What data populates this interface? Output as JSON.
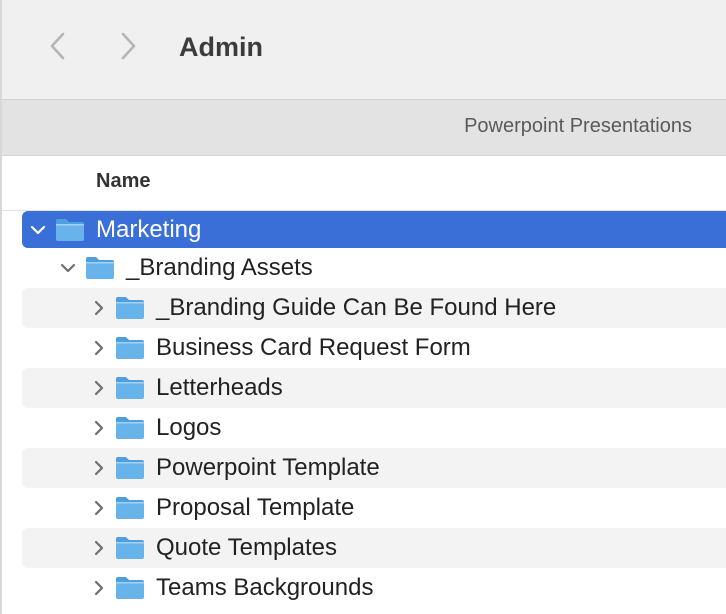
{
  "window": {
    "title": "Admin"
  },
  "pathbar": {
    "label": "Powerpoint Presentations"
  },
  "columns": {
    "name": "Name"
  },
  "colors": {
    "selection": "#3a6fd8",
    "folder": "#69b3eb",
    "zebra": "#f3f3f3"
  },
  "rows": [
    {
      "label": "Marketing",
      "level": 0,
      "expanded": true,
      "selected": true,
      "icon": "folder-icon"
    },
    {
      "label": "_Branding Assets",
      "level": 1,
      "expanded": true,
      "selected": false,
      "icon": "folder-icon"
    },
    {
      "label": "_Branding Guide Can Be Found Here",
      "level": 2,
      "expanded": false,
      "selected": false,
      "icon": "folder-icon"
    },
    {
      "label": "Business Card Request Form",
      "level": 2,
      "expanded": false,
      "selected": false,
      "icon": "folder-icon"
    },
    {
      "label": "Letterheads",
      "level": 2,
      "expanded": false,
      "selected": false,
      "icon": "folder-icon"
    },
    {
      "label": "Logos",
      "level": 2,
      "expanded": false,
      "selected": false,
      "icon": "folder-icon"
    },
    {
      "label": "Powerpoint Template",
      "level": 2,
      "expanded": false,
      "selected": false,
      "icon": "folder-icon"
    },
    {
      "label": "Proposal Template",
      "level": 2,
      "expanded": false,
      "selected": false,
      "icon": "folder-icon"
    },
    {
      "label": "Quote Templates",
      "level": 2,
      "expanded": false,
      "selected": false,
      "icon": "folder-icon"
    },
    {
      "label": "Teams Backgrounds",
      "level": 2,
      "expanded": false,
      "selected": false,
      "icon": "folder-icon"
    }
  ]
}
